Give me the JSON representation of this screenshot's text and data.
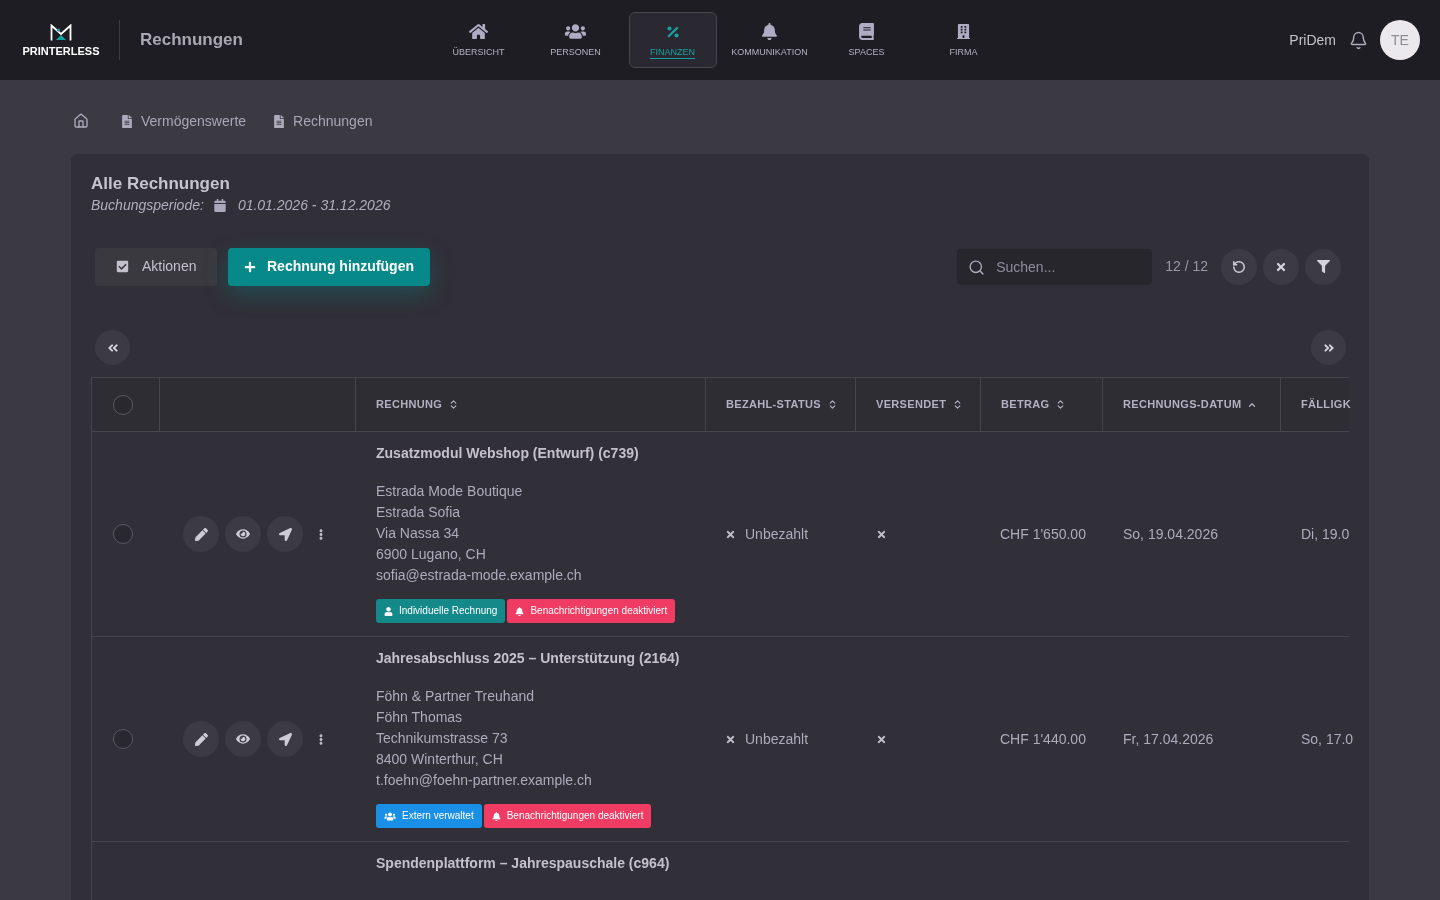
{
  "header": {
    "brand": "PRINTERLESS",
    "page_title": "Rechnungen",
    "nav": [
      {
        "label": "ÜBERSICHT",
        "selected": false
      },
      {
        "label": "PERSONEN",
        "selected": false
      },
      {
        "label": "FINANZEN",
        "selected": true
      },
      {
        "label": "KOMMUNIKATION",
        "selected": false
      },
      {
        "label": "SPACES",
        "selected": false
      },
      {
        "label": "FIRMA",
        "selected": false
      }
    ],
    "user_name": "PriDem",
    "avatar_initials": "TE"
  },
  "breadcrumb": [
    "Vermögenswerte",
    "Rechnungen"
  ],
  "card": {
    "title": "Alle Rechnungen",
    "period_label": "Buchungsperiode:",
    "period": "01.01.2026 - 31.12.2026",
    "actions_button": "Aktionen",
    "add_button": "Rechnung hinzufügen",
    "search": {
      "placeholder": "Suchen..."
    },
    "count": "12 / 12"
  },
  "table": {
    "select_all": {
      "checked": false
    },
    "columns": [
      {
        "label": "RECHNUNG",
        "sorted": false
      },
      {
        "label": "BEZAHL-STATUS",
        "sorted": false
      },
      {
        "label": "VERSENDET",
        "sorted": false
      },
      {
        "label": "BETRAG",
        "sorted": false
      },
      {
        "label": "RECHNUNGS-DATUM",
        "sorted": true
      },
      {
        "label": "FÄLLIGK"
      }
    ],
    "rows": [
      {
        "selected": false,
        "title": "Zusatzmodul Webshop (Entwurf) (c739)",
        "address": [
          "Estrada Mode Boutique",
          "Estrada Sofia",
          "Via Nassa 34",
          "6900 Lugano, CH",
          "sofia@estrada-mode.example.ch"
        ],
        "tags": [
          {
            "kind": "individual",
            "label": "Individuelle Rechnung",
            "color": "#13898a"
          },
          {
            "kind": "notifications_off",
            "label": "Benachrichtigungen deaktiviert",
            "color": "#f03c63"
          }
        ],
        "paid": false,
        "status": "Unbezahlt",
        "sent": false,
        "amount": "CHF 1'650.00",
        "date": "So, 19.04.2026",
        "due": "Di, 19.0"
      },
      {
        "selected": false,
        "title": "Jahresabschluss 2025 – Unterstützung (2164)",
        "address": [
          "Föhn & Partner Treuhand",
          "Föhn Thomas",
          "Technikumstrasse 73",
          "8400 Winterthur, CH",
          "t.foehn@foehn-partner.example.ch"
        ],
        "tags": [
          {
            "kind": "external",
            "label": "Extern verwaltet",
            "color": "#1a8fe6"
          },
          {
            "kind": "notifications_off",
            "label": "Benachrichtigungen deaktiviert",
            "color": "#f03c63"
          }
        ],
        "paid": false,
        "status": "Unbezahlt",
        "sent": false,
        "amount": "CHF 1'440.00",
        "date": "Fr, 17.04.2026",
        "due": "So, 17.0"
      },
      {
        "title": "Spendenplattform – Jahrespauschale (c964)"
      }
    ]
  }
}
